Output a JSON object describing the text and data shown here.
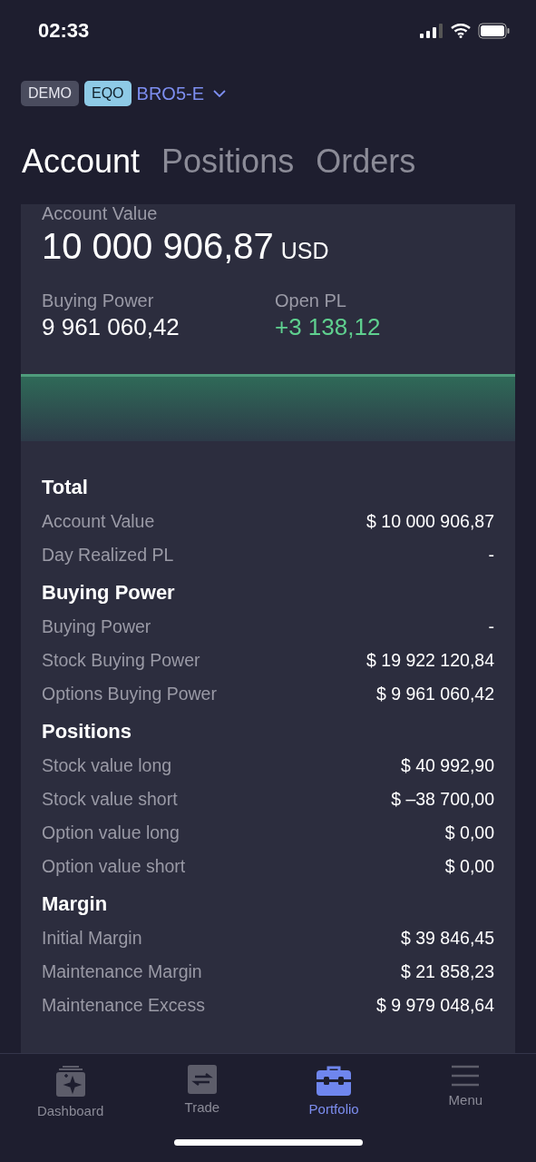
{
  "status_bar": {
    "time": "02:33"
  },
  "account": {
    "badges": [
      {
        "label": "DEMO",
        "kind": "demo"
      },
      {
        "label": "EQO",
        "kind": "type"
      }
    ],
    "name": "BRO5-E"
  },
  "tabs": [
    {
      "label": "Account",
      "selected": true
    },
    {
      "label": "Positions",
      "selected": false
    },
    {
      "label": "Orders",
      "selected": false
    }
  ],
  "summary": {
    "label": "Account Value",
    "value": "10 000 906,87",
    "currency": "USD",
    "stats": [
      {
        "label": "Buying Power",
        "value": "9 961 060,42",
        "kind": "neutral"
      },
      {
        "label": "Open PL",
        "value": "+3 138,12",
        "kind": "positive"
      }
    ]
  },
  "sections": [
    {
      "title": "Total",
      "rows": [
        {
          "label": "Account Value",
          "value": "$ 10 000 906,87"
        },
        {
          "label": "Day Realized PL",
          "value": "-"
        }
      ]
    },
    {
      "title": "Buying Power",
      "rows": [
        {
          "label": "Buying Power",
          "value": "-"
        },
        {
          "label": "Stock Buying Power",
          "value": "$ 19 922 120,84"
        },
        {
          "label": "Options Buying Power",
          "value": "$ 9 961 060,42"
        }
      ]
    },
    {
      "title": "Positions",
      "rows": [
        {
          "label": "Stock value long",
          "value": "$ 40 992,90"
        },
        {
          "label": "Stock value short",
          "value": "$ –38 700,00"
        },
        {
          "label": "Option value long",
          "value": "$ 0,00"
        },
        {
          "label": "Option value short",
          "value": "$ 0,00"
        }
      ]
    },
    {
      "title": "Margin",
      "rows": [
        {
          "label": "Initial Margin",
          "value": "$ 39 846,45"
        },
        {
          "label": "Maintenance Margin",
          "value": "$ 21 858,23"
        },
        {
          "label": "Maintenance Excess",
          "value": "$ 9 979 048,64"
        }
      ]
    }
  ],
  "tab_bar": [
    {
      "label": "Dashboard",
      "kind": "dashboard",
      "selected": false
    },
    {
      "label": "Trade",
      "kind": "trade",
      "selected": false
    },
    {
      "label": "Portfolio",
      "kind": "portfolio",
      "selected": true
    },
    {
      "label": "Menu",
      "kind": "menu",
      "selected": false
    }
  ]
}
